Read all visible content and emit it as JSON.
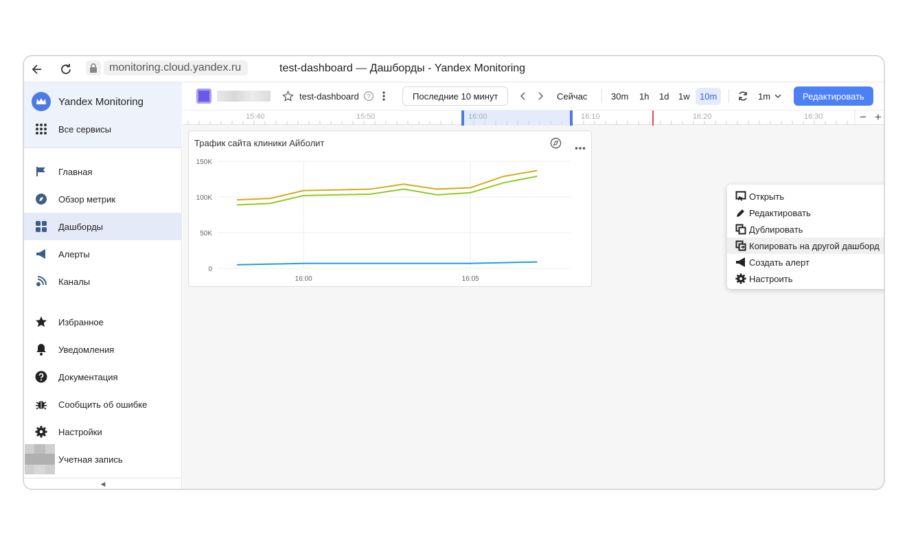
{
  "browser": {
    "url": "monitoring.cloud.yandex.ru",
    "tab_title": "test-dashboard — Дашборды - Yandex Monitoring"
  },
  "sidebar": {
    "brand": "Yandex Monitoring",
    "all_services": "Все сервисы",
    "nav": [
      {
        "label": "Главная",
        "icon": "flag-icon"
      },
      {
        "label": "Обзор метрик",
        "icon": "compass-icon"
      },
      {
        "label": "Дашборды",
        "icon": "dashboard-icon",
        "active": true
      },
      {
        "label": "Алерты",
        "icon": "megaphone-icon"
      },
      {
        "label": "Каналы",
        "icon": "channel-icon"
      }
    ],
    "bottom": [
      {
        "label": "Избранное",
        "icon": "star-icon"
      },
      {
        "label": "Уведомления",
        "icon": "bell-icon"
      },
      {
        "label": "Документация",
        "icon": "help-icon"
      },
      {
        "label": "Сообщить об ошибке",
        "icon": "bug-icon"
      },
      {
        "label": "Настройки",
        "icon": "gear-icon"
      },
      {
        "label": "Учетная запись",
        "icon": "avatar"
      }
    ],
    "collapse": "◀"
  },
  "toolbar": {
    "dashboard_name": "test-dashboard",
    "time_range": "Последние 10 минут",
    "now": "Сейчас",
    "scales": [
      "30m",
      "1h",
      "1d",
      "1w",
      "10m"
    ],
    "selected_scale": "10m",
    "refresh_interval": "1m",
    "edit": "Редактировать"
  },
  "timeline": {
    "ticks": [
      "15:40",
      "15:50",
      "16:00",
      "16:10",
      "16:20",
      "16:30"
    ],
    "zoom_out": "−",
    "zoom_in": "+"
  },
  "panel": {
    "title": "Трафик сайта клиники Айболит"
  },
  "chart_data": {
    "type": "line",
    "title": "Трафик сайта клиники Айболит",
    "x": [
      "15:58",
      "15:59",
      "16:00",
      "16:01",
      "16:02",
      "16:03",
      "16:04",
      "16:05",
      "16:06",
      "16:07",
      "16:08"
    ],
    "ytick_labels": [
      "150K",
      "100K",
      "50K",
      "0"
    ],
    "xtick_labels": [
      "16:00",
      "16:05"
    ],
    "ylim": [
      0,
      150000
    ],
    "grid": true,
    "series": [
      {
        "color": "#d4aa1e",
        "values": [
          96000,
          98000,
          109000,
          110000,
          111000,
          118000,
          111000,
          113000,
          129000,
          137000
        ]
      },
      {
        "color": "#8fcc1f",
        "values": [
          89000,
          91000,
          102000,
          103000,
          104000,
          111000,
          103000,
          106000,
          120000,
          129000
        ]
      },
      {
        "color": "#1e9fd8",
        "values": [
          5000,
          6000,
          7000,
          7000,
          7000,
          7000,
          7000,
          7000,
          8000,
          9000
        ]
      }
    ]
  },
  "context_menu": {
    "items": [
      {
        "label": "Открыть",
        "icon": "open-icon"
      },
      {
        "label": "Редактировать",
        "icon": "pencil-icon"
      },
      {
        "label": "Дублировать",
        "icon": "duplicate-icon"
      },
      {
        "label": "Копировать на другой дашборд",
        "icon": "copy-to-icon",
        "hover": true
      },
      {
        "label": "Создать алерт",
        "icon": "alert-icon"
      },
      {
        "label": "Настроить",
        "icon": "settings-icon"
      }
    ]
  }
}
